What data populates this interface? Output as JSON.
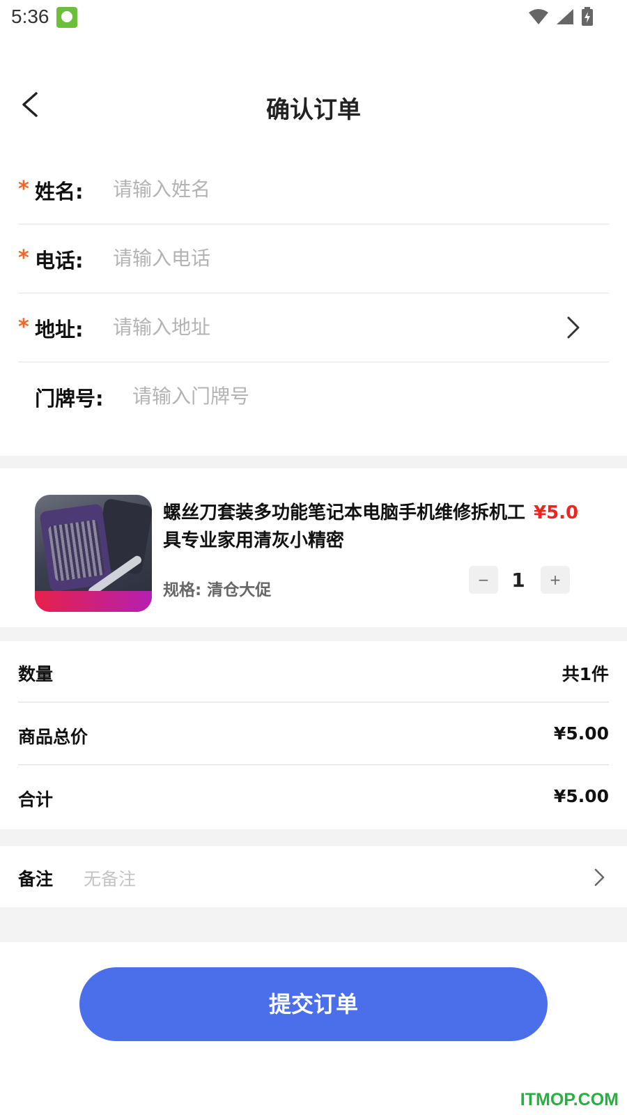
{
  "status_bar": {
    "time": "5:36",
    "icons": [
      "app-notification-icon",
      "wifi-icon",
      "signal-icon",
      "battery-charging-icon"
    ]
  },
  "header": {
    "title": "确认订单",
    "back_icon": "back-arrow-icon"
  },
  "form": {
    "fields": [
      {
        "label": "姓名:",
        "placeholder": "请输入姓名",
        "value": "",
        "required": true
      },
      {
        "label": "电话:",
        "placeholder": "请输入电话",
        "value": "",
        "required": true
      },
      {
        "label": "地址:",
        "placeholder": "请输入地址",
        "value": "",
        "required": true,
        "icon": "chevron-right-icon"
      },
      {
        "label": "门牌号:",
        "placeholder": "请输入门牌号",
        "value": "",
        "required": false
      }
    ],
    "required_mark": "*"
  },
  "product": {
    "title": "螺丝刀套装多功能笔记本电脑手机维修拆机工具专业家用清灰小精密",
    "price": "¥5.0",
    "spec": "规格: 清仓大促",
    "quantity": "1",
    "minus_label": "−",
    "plus_label": "+"
  },
  "summary": {
    "rows": [
      {
        "label": "数量",
        "value": "共1件"
      },
      {
        "label": "商品总价",
        "value": "¥5.00"
      },
      {
        "label": "合计",
        "value": "¥5.00"
      }
    ]
  },
  "note": {
    "label": "备注",
    "value": "无备注",
    "icon": "chevron-right-icon"
  },
  "submit": {
    "label": "提交订单"
  },
  "watermark": "ITMOP.COM",
  "colors": {
    "accent": "#4b6fea",
    "price": "#f0231e",
    "required": "#f0662b",
    "divider_bg": "#f3f3f3"
  }
}
